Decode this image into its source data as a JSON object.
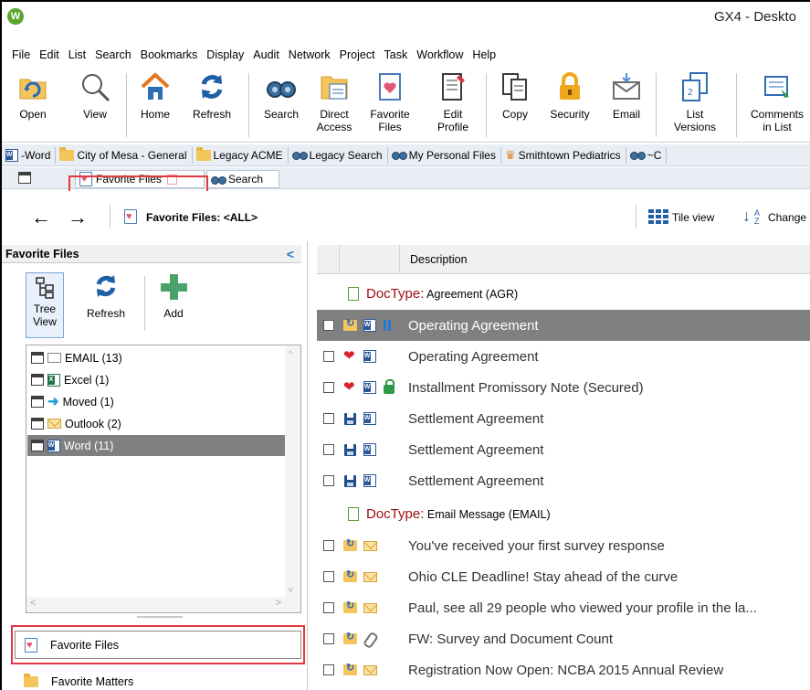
{
  "app": {
    "title": "GX4 - Deskto",
    "logo": "W"
  },
  "menu": [
    "File",
    "Edit",
    "List",
    "Search",
    "Bookmarks",
    "Display",
    "Audit",
    "Network",
    "Project",
    "Task",
    "Workflow",
    "Help"
  ],
  "ribbon": {
    "open": "Open",
    "view": "View",
    "home": "Home",
    "refresh": "Refresh",
    "search": "Search",
    "direct_access_1": "Direct",
    "direct_access_2": "Access",
    "favorite_files_1": "Favorite",
    "favorite_files_2": "Files",
    "edit_profile_1": "Edit",
    "edit_profile_2": "Profile",
    "copy": "Copy",
    "security": "Security",
    "email": "Email",
    "list_versions_1": "List",
    "list_versions_2": "Versions",
    "comments_1": "Comments",
    "comments_2": "in List"
  },
  "bookmarks": [
    "-Word",
    "City of Mesa - General",
    "Legacy ACME",
    "Legacy Search",
    "My Personal Files",
    "Smithtown Pediatrics",
    "~C"
  ],
  "tabs": [
    {
      "label": "Favorite Files"
    },
    {
      "label": "Search"
    }
  ],
  "nav": {
    "location": "Favorite Files: <ALL>",
    "tile_view": "Tile view",
    "change": "Change"
  },
  "left": {
    "header": "Favorite Files",
    "tree_view_1": "Tree",
    "tree_view_2": "View",
    "refresh": "Refresh",
    "add": "Add",
    "tree": [
      {
        "label": "EMAIL (13)",
        "icon": "envelope-icon"
      },
      {
        "label": "Excel (1)",
        "icon": "excel-icon"
      },
      {
        "label": "Moved (1)",
        "icon": "arrow-right-icon"
      },
      {
        "label": "Outlook (2)",
        "icon": "envelope-icon"
      },
      {
        "label": "Word (11)",
        "icon": "word-icon"
      }
    ],
    "bottom_buttons": [
      "Favorite Files",
      "Favorite Matters"
    ]
  },
  "right": {
    "column": "Description",
    "groups": [
      {
        "prefix": "DocType:",
        "value": "Agreement (AGR)"
      },
      {
        "prefix": "DocType:",
        "value": "Email Message (EMAIL)"
      }
    ],
    "rows": [
      "Operating Agreement",
      "Operating Agreement",
      "Installment Promissory Note (Secured)",
      "Settlement Agreement",
      "Settlement Agreement",
      "Settlement Agreement",
      "You've received your first survey response",
      "Ohio CLE Deadline! Stay ahead of the curve",
      "Paul, see all 29 people who viewed your profile in the la...",
      "FW: Survey and Document Count",
      "Registration Now Open: NCBA 2015 Annual Review"
    ]
  },
  "colors": {
    "selection": "#808080",
    "highlight": "#e0393e",
    "doctype": "#9b0f0f"
  }
}
